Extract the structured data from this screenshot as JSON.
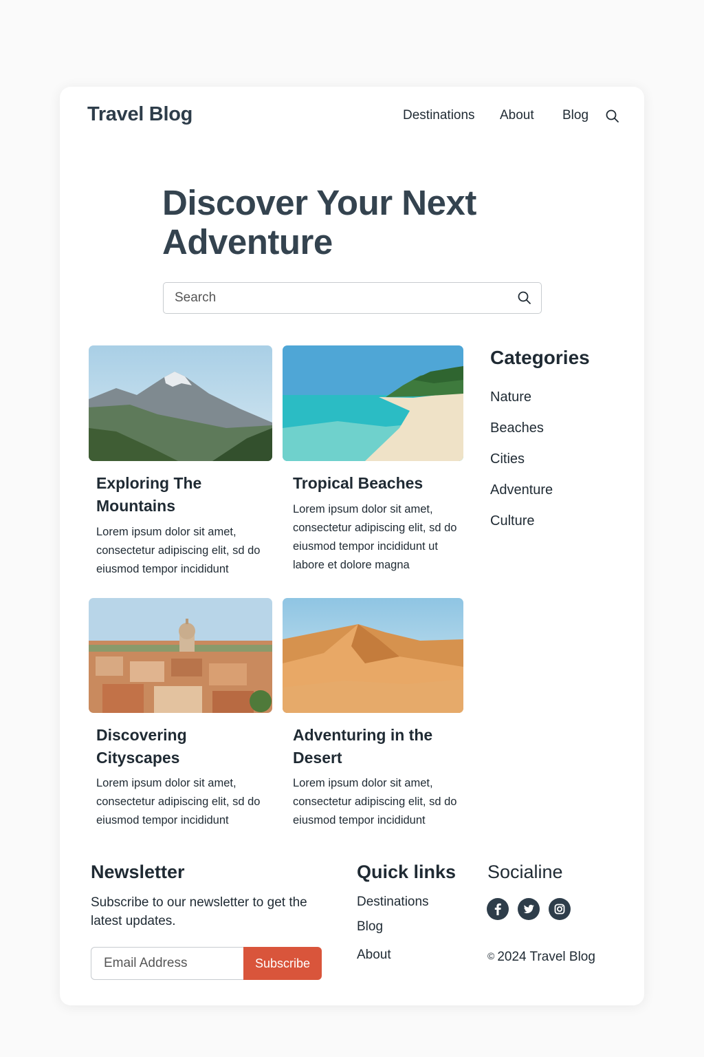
{
  "header": {
    "brand": "Travel Blog",
    "nav": [
      "Destinations",
      "About",
      "Blog"
    ],
    "search_icon": "search-icon"
  },
  "hero": {
    "title": "Discover Your Next Adventure",
    "search_placeholder": "Search"
  },
  "posts": [
    {
      "title": "Exploring The Mountains",
      "excerpt": "Lorem ipsum dolor sit amet, consectetur adipiscing elit, sd do eiusmod tempor incididunt",
      "image": "mountain-photo"
    },
    {
      "title": "Tropical Beaches",
      "excerpt": "Lorem ipsum dolor sit amet, consectetur adipiscing elit, sd do eiusmod tempor incididunt ut labore et dolore magna",
      "image": "beach-photo"
    },
    {
      "title": "Discovering Cityscapes",
      "excerpt": "Lorem ipsum dolor sit amet, consectetur adipiscing elit, sd do eiusmod tempor incididunt",
      "image": "city-photo"
    },
    {
      "title": "Adventuring in the Desert",
      "excerpt": "Lorem ipsum dolor sit amet, consectetur adipiscing elit, sd do eiusmod tempor incididunt",
      "image": "desert-photo"
    }
  ],
  "sidebar": {
    "heading": "Categories",
    "items": [
      "Nature",
      "Beaches",
      "Cities",
      "Adventure",
      "Culture"
    ]
  },
  "footer": {
    "newsletter": {
      "heading": "Newsletter",
      "text": "Subscribe to our newsletter to get the latest updates.",
      "email_placeholder": "Email Address",
      "button": "Subscribe"
    },
    "quick_links": {
      "heading": "Quick links",
      "items": [
        "Destinations",
        "Blog",
        "About"
      ]
    },
    "social": {
      "heading": "Socialine",
      "icons": [
        "facebook-icon",
        "twitter-icon",
        "instagram-icon"
      ]
    },
    "copyright": "2024 Travel Blog"
  },
  "colors": {
    "accent": "#d9553b",
    "heading": "#34434f",
    "text": "#1f2a33",
    "social_bg": "#2e3d4a"
  }
}
